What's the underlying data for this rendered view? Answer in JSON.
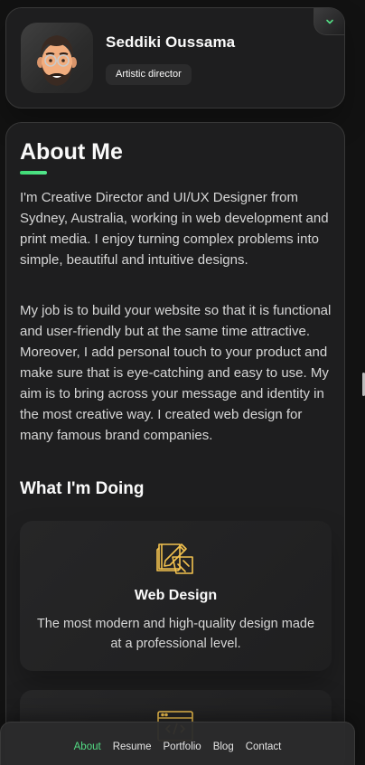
{
  "profile": {
    "name": "Seddiki Oussama",
    "title": "Artistic director",
    "avatar_icon": "memoji-avatar"
  },
  "about": {
    "title": "About Me",
    "paragraphs": [
      "I'm Creative Director and UI/UX Designer from Sydney, Australia, working in web development and print media. I enjoy turning complex problems into simple, beautiful and intuitive designs.",
      "My job is to build your website so that it is functional and user-friendly but at the same time attractive. Moreover, I add personal touch to your product and make sure that is eye-catching and easy to use. My aim is to bring across your message and identity in the most creative way. I created web design for many famous brand companies."
    ]
  },
  "services": {
    "heading": "What I'm Doing",
    "items": [
      {
        "icon": "design-tools-icon",
        "title": "Web Design",
        "description": "The most modern and high-quality design made at a professional level."
      },
      {
        "icon": "code-window-icon"
      }
    ]
  },
  "nav": {
    "items": [
      "About",
      "Resume",
      "Portfolio",
      "Blog",
      "Contact"
    ],
    "active": "About"
  },
  "colors": {
    "accent": "#53dc84",
    "icon_gold": "#f2c14e",
    "card_bg": "#1e1e1f",
    "page_bg": "#121212"
  }
}
